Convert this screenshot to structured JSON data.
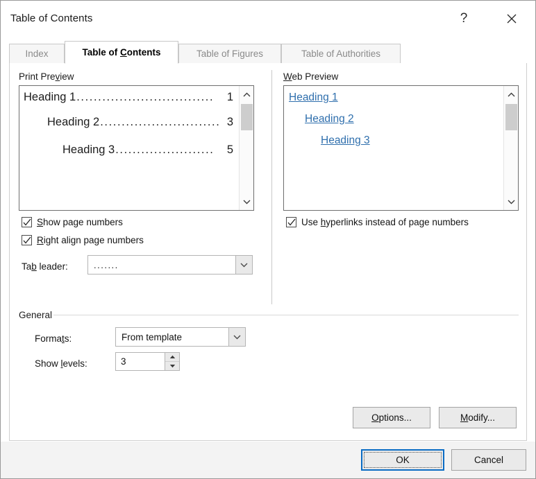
{
  "window": {
    "title": "Table of Contents",
    "help_icon": "help-question-icon",
    "close_icon": "close-x-icon"
  },
  "tabs": [
    {
      "label": "Index",
      "active": false
    },
    {
      "label": "Table of Contents",
      "active": true,
      "accel": "C"
    },
    {
      "label": "Table of Figures",
      "active": false
    },
    {
      "label": "Table of Authorities",
      "active": false
    }
  ],
  "print_preview": {
    "group_label": "Print Preview",
    "group_label_accel": "v",
    "entries": [
      {
        "label": "Heading 1",
        "page": "1",
        "level": 1,
        "leader": "................................"
      },
      {
        "label": "Heading 2",
        "page": "3",
        "level": 2,
        "leader": "............................"
      },
      {
        "label": "Heading 3",
        "page": "5",
        "level": 3,
        "leader": "......................."
      }
    ],
    "scrollbar": {
      "up_icon": "chevron-up-icon",
      "down_icon": "chevron-down-icon"
    },
    "show_page_numbers": {
      "label": "Show page numbers",
      "accel": "S",
      "checked": true
    },
    "right_align_page_numbers": {
      "label": "Right align page numbers",
      "accel": "R",
      "checked": true
    },
    "tab_leader": {
      "label": "Tab leader:",
      "accel": "b",
      "value": ".......",
      "arrow_icon": "chevron-down-icon"
    }
  },
  "web_preview": {
    "group_label": "Web Preview",
    "group_label_accel": "W",
    "entries": [
      {
        "label": "Heading 1",
        "level": 1
      },
      {
        "label": "Heading 2",
        "level": 2
      },
      {
        "label": "Heading 3",
        "level": 3
      }
    ],
    "link_color": "#2f6fad",
    "scrollbar": {
      "up_icon": "chevron-up-icon",
      "down_icon": "chevron-down-icon"
    },
    "use_hyperlinks": {
      "label": "Use hyperlinks instead of page numbers",
      "accel": "h",
      "checked": true
    }
  },
  "general": {
    "group_label": "General",
    "formats": {
      "label": "Formats:",
      "accel": "t",
      "value": "From template",
      "arrow_icon": "chevron-down-icon"
    },
    "show_levels": {
      "label": "Show levels:",
      "accel": "l",
      "value": "3",
      "up_icon": "spinner-up-icon",
      "down_icon": "spinner-down-icon"
    }
  },
  "actions": {
    "options": {
      "label": "Options...",
      "accel": "O"
    },
    "modify": {
      "label": "Modify...",
      "accel": "M"
    },
    "ok": {
      "label": "OK",
      "focused": true
    },
    "cancel": {
      "label": "Cancel"
    }
  },
  "colors": {
    "accent": "#0a6cc4",
    "link": "#2f6fad",
    "border": "#6e6e6e",
    "footer_bg": "#f3f3f3"
  }
}
